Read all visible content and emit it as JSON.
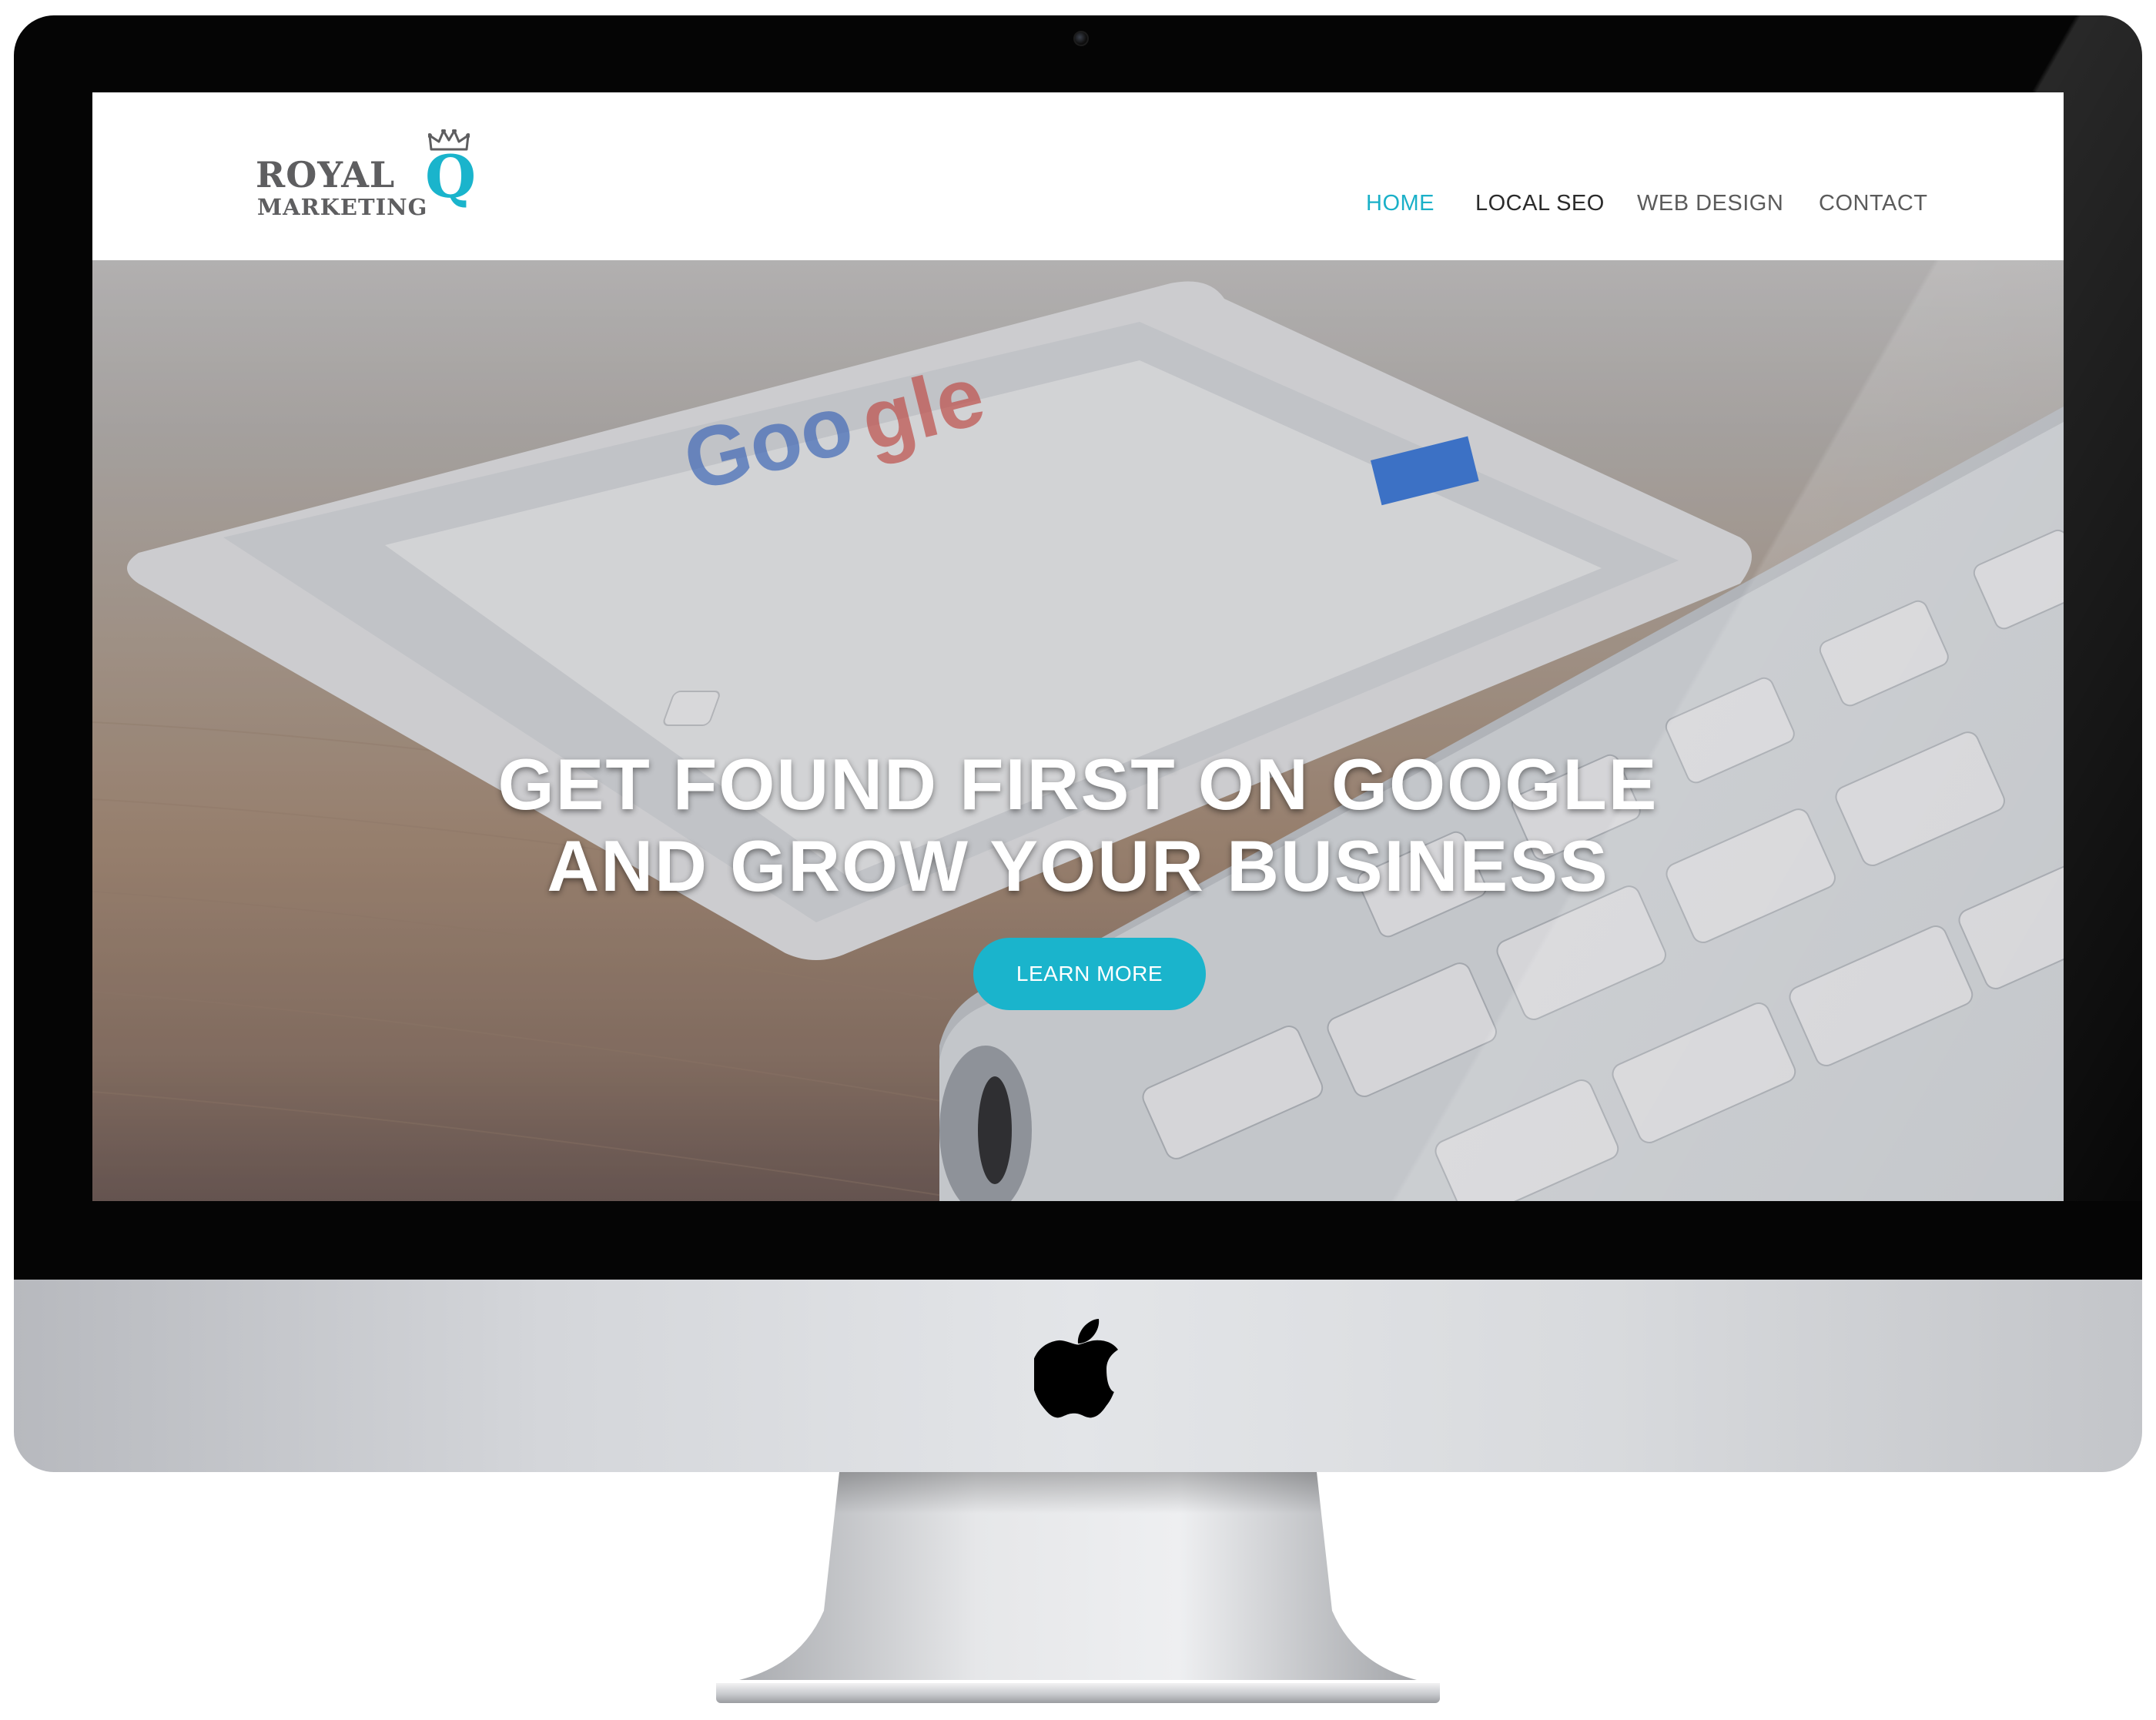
{
  "site": {
    "logo": {
      "royal": "ROYAL",
      "q": "Q",
      "marketing": "MARKETING"
    },
    "nav": {
      "items": [
        {
          "label": "HOME",
          "state": "active"
        },
        {
          "label": "LOCAL SEO",
          "state": "default"
        },
        {
          "label": "WEB DESIGN",
          "state": "default"
        },
        {
          "label": "CONTACT",
          "state": "default"
        }
      ]
    },
    "hero": {
      "title_line1": "GET FOUND FIRST ON GOOGLE",
      "title_line2": "AND GROW YOUR BUSINESS",
      "cta_label": "LEARN MORE"
    }
  },
  "colors": {
    "accent": "#1ab4cc",
    "logo_text": "#5e5e60",
    "nav_text": "#5b5b5b",
    "bezel": "#050505"
  },
  "icons": {
    "crown": "crown-icon",
    "apple": "apple-logo-icon"
  }
}
